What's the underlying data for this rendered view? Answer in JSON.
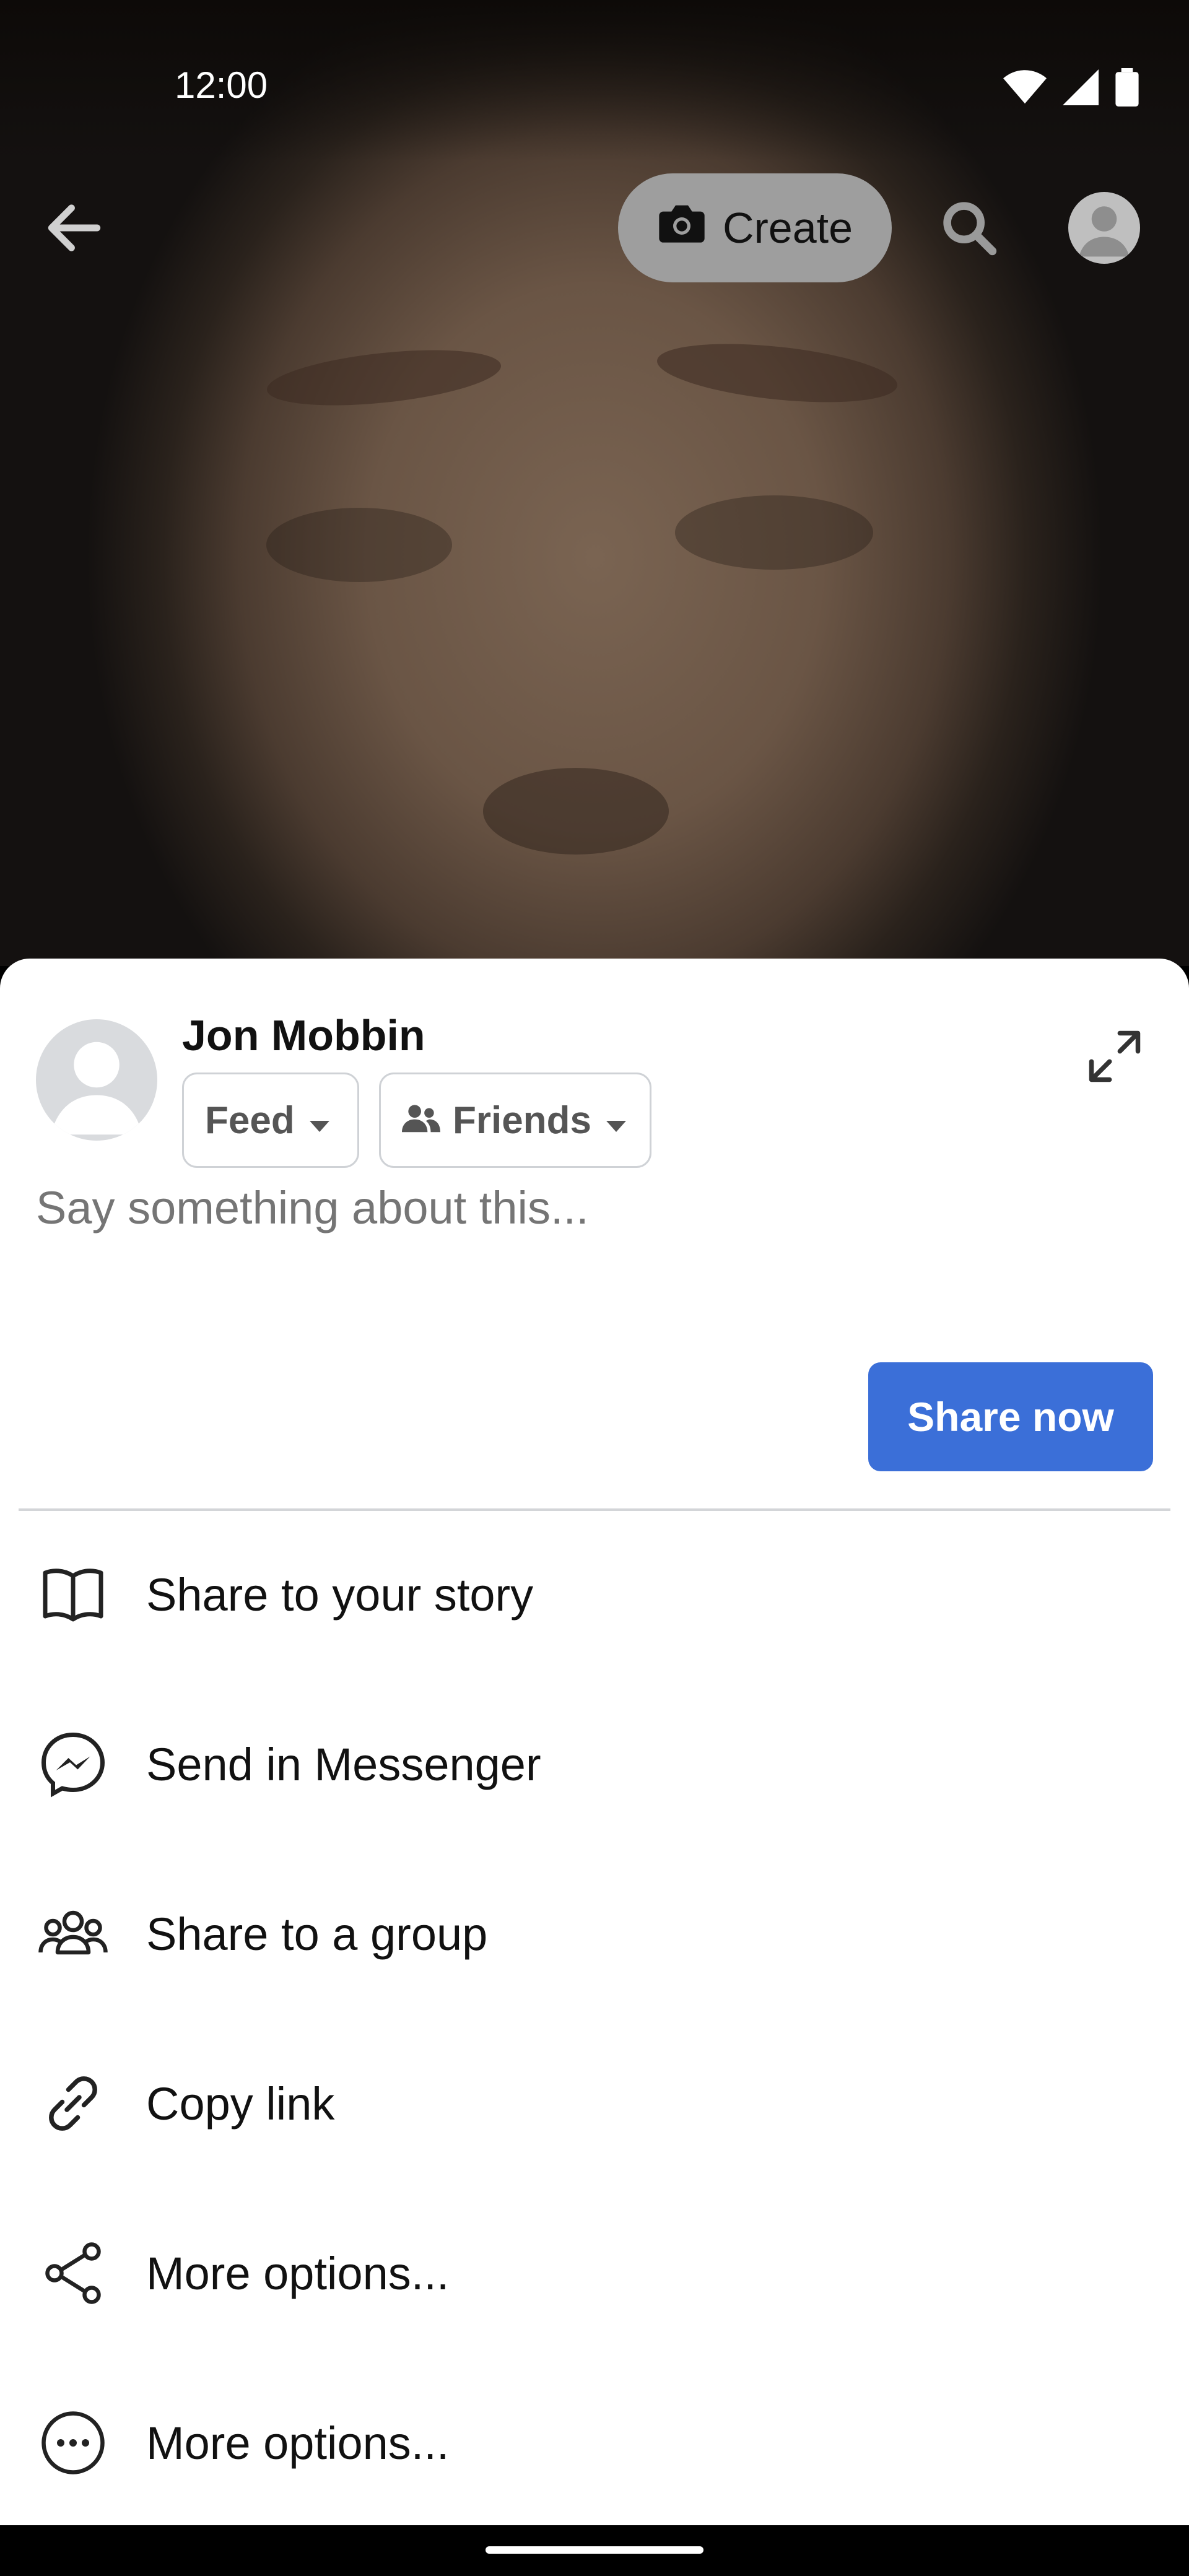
{
  "status_bar": {
    "time": "12:00",
    "icons": [
      "wifi-icon",
      "cellular-icon",
      "battery-icon"
    ]
  },
  "top_bar": {
    "create_label": "Create",
    "icons": [
      "back-arrow-icon",
      "camera-icon",
      "search-icon",
      "profile-avatar"
    ]
  },
  "share_sheet": {
    "user_name": "Jon Mobbin",
    "destination": "Feed",
    "audience": "Friends",
    "caption_placeholder": "Say something about this...",
    "share_button": "Share now",
    "options": [
      {
        "label": "Share to your story",
        "icon": "book-icon"
      },
      {
        "label": "Send in Messenger",
        "icon": "messenger-icon"
      },
      {
        "label": "Share to a group",
        "icon": "group-icon"
      },
      {
        "label": "Copy link",
        "icon": "link-icon"
      },
      {
        "label": "More options...",
        "icon": "share-icon"
      },
      {
        "label": "More options...",
        "icon": "more-horizontal-icon"
      }
    ]
  },
  "colors": {
    "accent": "#3b6fd8",
    "sheet_bg": "#ffffff",
    "create_pill": "#9e9e9e"
  }
}
